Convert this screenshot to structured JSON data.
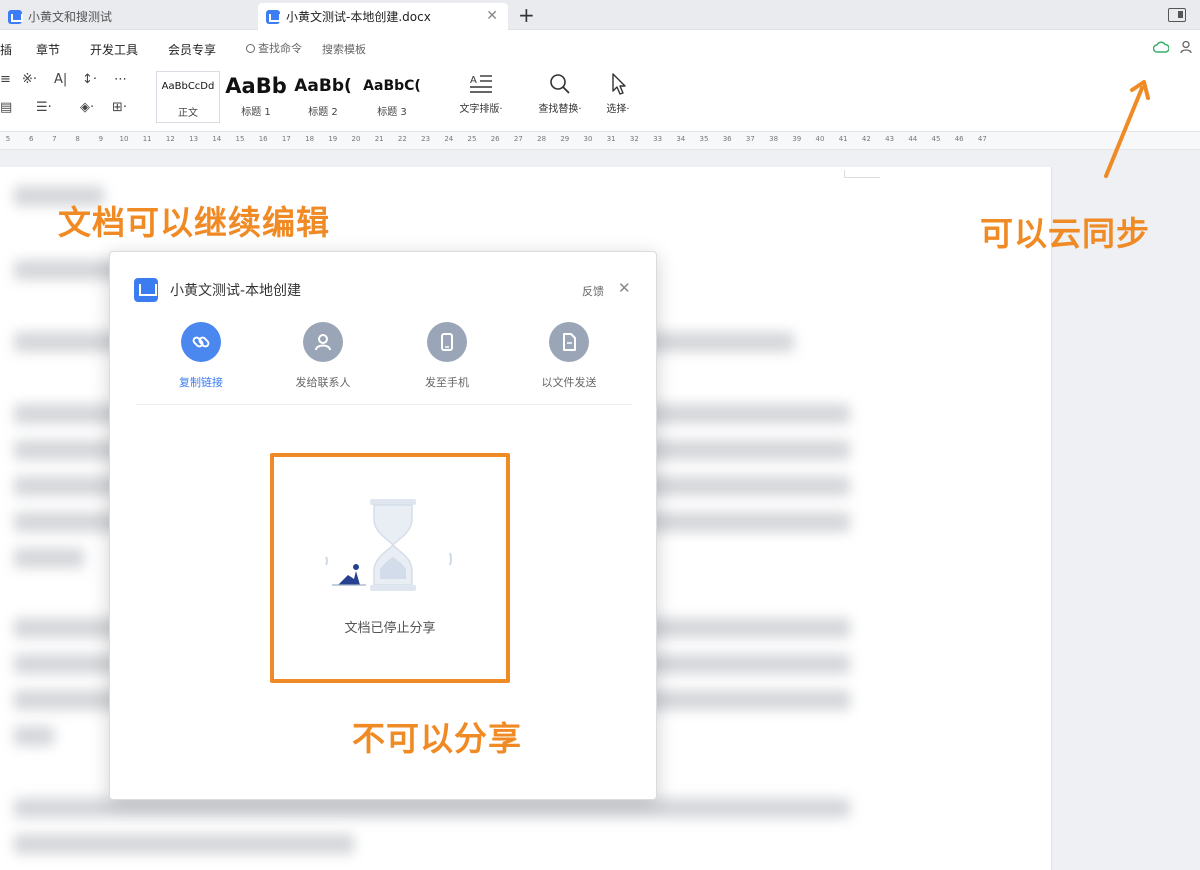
{
  "tabs": [
    {
      "label": "小黄文和搜测试"
    },
    {
      "label": "小黄文测试-本地创建.docx"
    }
  ],
  "menu": {
    "items": [
      "插",
      "章节",
      "开发工具",
      "会员专享"
    ],
    "search_command": "查找命令",
    "search_template": "搜索模板"
  },
  "ribbon": {
    "styles": [
      {
        "preview": "AaBbCcDd",
        "label": "正文"
      },
      {
        "preview": "AaBb",
        "label": "标题 1"
      },
      {
        "preview": "AaBb(",
        "label": "标题 2"
      },
      {
        "preview": "AaBbC(",
        "label": "标题 3"
      }
    ],
    "text_layout": "文字排版·",
    "find_replace": "查找替换·",
    "select": "选择·"
  },
  "ruler": [
    "5",
    "6",
    "7",
    "8",
    "9",
    "10",
    "11",
    "12",
    "13",
    "14",
    "15",
    "16",
    "17",
    "18",
    "19",
    "20",
    "21",
    "22",
    "23",
    "24",
    "25",
    "26",
    "27",
    "28",
    "29",
    "30",
    "31",
    "32",
    "33",
    "34",
    "35",
    "36",
    "37",
    "38",
    "39",
    "40",
    "41",
    "42",
    "43",
    "44",
    "45",
    "46",
    "47"
  ],
  "annotations": {
    "editable": "文档可以继续编辑",
    "cloud_sync": "可以云同步",
    "no_share": "不可以分享"
  },
  "dialog": {
    "title": "小黄文测试-本地创建",
    "feedback": "反馈",
    "options": [
      {
        "label": "复制链接",
        "icon": "link-icon"
      },
      {
        "label": "发给联系人",
        "icon": "contact-icon"
      },
      {
        "label": "发至手机",
        "icon": "phone-icon"
      },
      {
        "label": "以文件发送",
        "icon": "file-icon"
      }
    ],
    "stopped_message": "文档已停止分享"
  },
  "colors": {
    "accent": "#f08a24",
    "primary": "#3b7cf0",
    "cloud_sync": "#35b06b"
  }
}
